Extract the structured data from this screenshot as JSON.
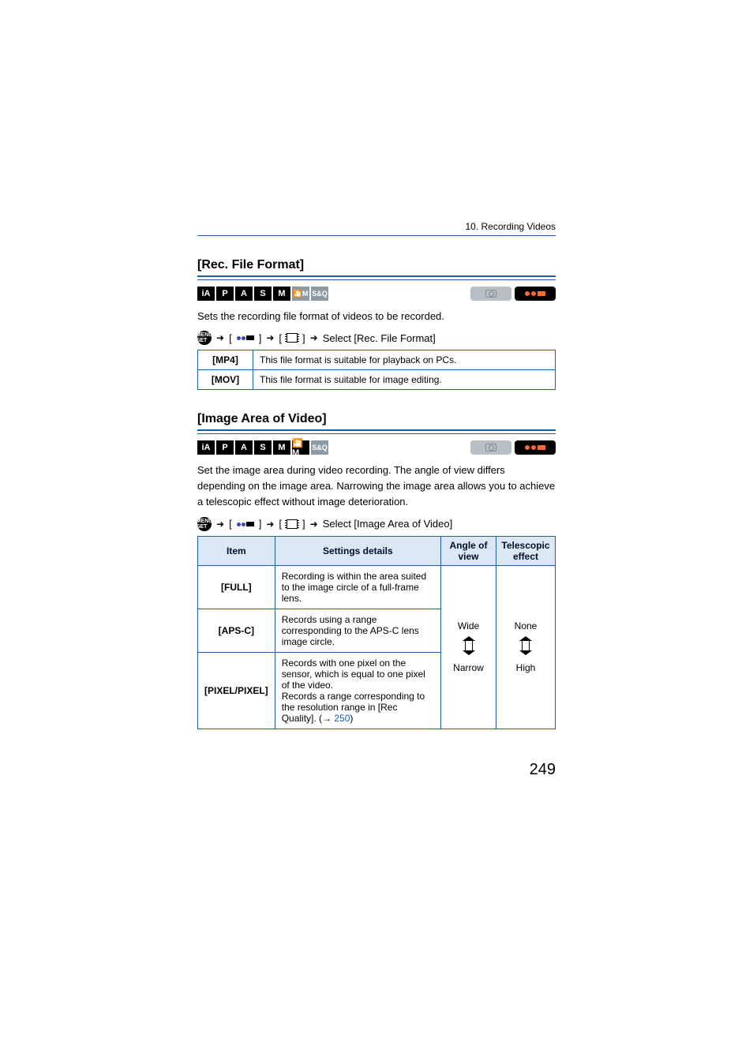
{
  "header": {
    "breadcrumb": "10. Recording Videos"
  },
  "modes_main": [
    "iA",
    "P",
    "A",
    "S",
    "M"
  ],
  "modes_faded": [
    "🎦M",
    "S&Q"
  ],
  "section1": {
    "title": "[Rec. File Format]",
    "desc": "Sets the recording file format of videos to be recorded.",
    "nav_suffix": "Select [Rec. File Format]",
    "rows": [
      {
        "name": "[MP4]",
        "desc": "This file format is suitable for playback on PCs."
      },
      {
        "name": "[MOV]",
        "desc": "This file format is suitable for image editing."
      }
    ]
  },
  "section2": {
    "title": "[Image Area of Video]",
    "desc": "Set the image area during video recording. The angle of view differs depending on the image area. Narrowing the image area allows you to achieve a telescopic effect without image deterioration.",
    "nav_suffix": "Select [Image Area of Video]",
    "headers": [
      "Item",
      "Settings details",
      "Angle of view",
      "Telescopic effect"
    ],
    "rows": [
      {
        "name": "[FULL]",
        "desc": "Recording is within the area suited to the image circle of a full-frame lens."
      },
      {
        "name": "[APS-C]",
        "desc": "Records using a range corresponding to the APS-C lens image circle."
      },
      {
        "name": "[PIXEL/PIXEL]",
        "desc_pre": "Records with one pixel on the sensor, which is equal to one pixel of the video.\nRecords a range corresponding to the resolution range in [Rec Quality]. (",
        "link": "250",
        "desc_post": ")"
      }
    ],
    "aov_top": "Wide",
    "aov_bot": "Narrow",
    "tel_top": "None",
    "tel_bot": "High"
  },
  "menuset_label": "MENU SET",
  "page_number": "249"
}
